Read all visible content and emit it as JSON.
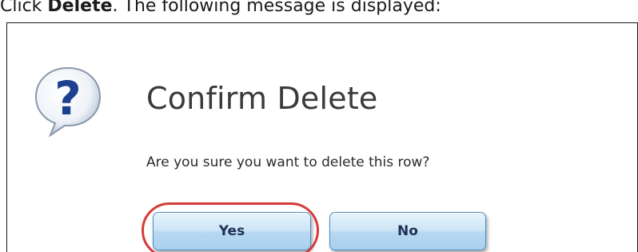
{
  "instruction": {
    "prefix": "Click ",
    "bold": "Delete",
    "suffix": ". The following message is displayed:"
  },
  "dialog": {
    "title": "Confirm Delete",
    "message": "Are you sure you want to delete this row?",
    "icon": "question-bubble-icon",
    "buttons": {
      "yes_label": "Yes",
      "no_label": "No"
    }
  },
  "annotation": {
    "highlight_target": "Yes",
    "highlight_color": "#d63a3a"
  },
  "colors": {
    "button_border": "#4a8ec2",
    "button_text": "#1f2f55",
    "icon_blue": "#1d3f8f"
  }
}
